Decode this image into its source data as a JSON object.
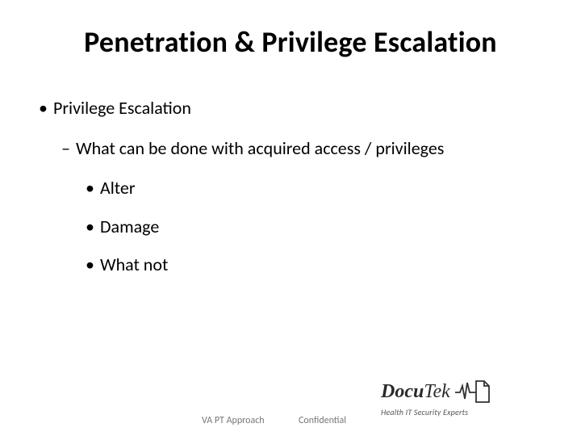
{
  "title": "Penetration & Privilege Escalation",
  "bullets": {
    "l1": "Privilege Escalation",
    "l2": "What can be done with acquired access / privileges",
    "l3a": "Alter",
    "l3b": "Damage",
    "l3c": "What not"
  },
  "footer": {
    "left": "VA PT Approach",
    "right": "Confidential"
  },
  "logo": {
    "brand_a": "Docu",
    "brand_b": "Tek",
    "tagline": "Health IT Security Experts"
  }
}
